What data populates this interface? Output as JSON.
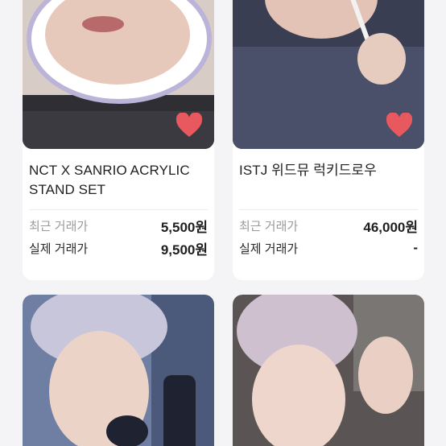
{
  "listings": [
    {
      "title_line1": "NCT X SANRIO ACRYLIC",
      "title_line2": "STAND SET",
      "recent_price_label": "최근 거래가",
      "recent_price": "5,500원",
      "actual_price_label": "실제 거래가",
      "actual_price": "9,500원",
      "liked": true,
      "heart_color": "#e8585f"
    },
    {
      "title_line1": "ISTJ 위드뮤 럭키드로우",
      "title_line2": "",
      "recent_price_label": "최근 거래가",
      "recent_price": "46,000원",
      "actual_price_label": "실제 거래가",
      "actual_price": "-",
      "liked": true,
      "heart_color": "#e8585f"
    },
    {
      "title_line1": "",
      "title_line2": ""
    },
    {
      "title_line1": "",
      "title_line2": ""
    }
  ],
  "colors": {
    "background": "#f4f4f6",
    "card": "#ffffff",
    "heart": "#e8585f",
    "muted_text": "#9a9a9a"
  }
}
